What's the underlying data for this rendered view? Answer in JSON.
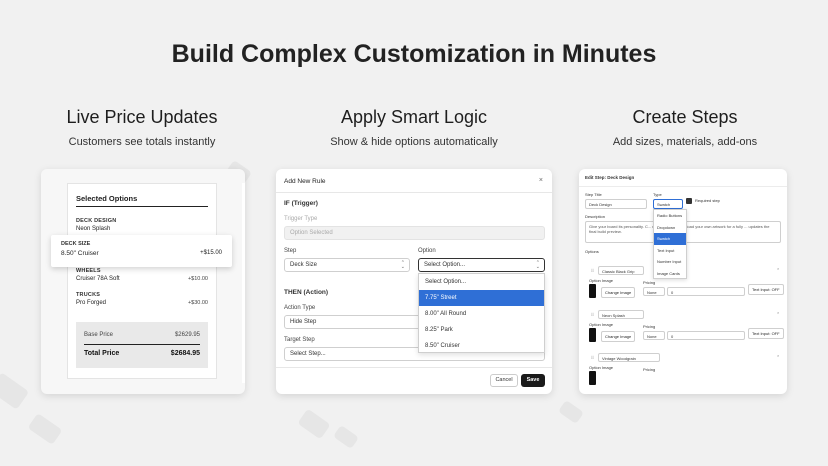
{
  "headline": "Build Complex Customization in Minutes",
  "columns": [
    {
      "title": "Live Price Updates",
      "subtitle": "Customers see totals instantly"
    },
    {
      "title": "Apply Smart Logic",
      "subtitle": "Show & hide options automatically"
    },
    {
      "title": "Create Steps",
      "subtitle": "Add sizes, materials, add-ons"
    }
  ],
  "card1": {
    "heading": "Selected Options",
    "deck_design_label": "DECK DESIGN",
    "deck_design_value": "Neon Splash",
    "popup_label": "DECK SIZE",
    "popup_value": "8.50\" Cruiser",
    "popup_price": "+$15.00",
    "wheels_label": "WHEELS",
    "wheels_value": "Cruiser 78A Soft",
    "wheels_price": "+$10.00",
    "trucks_label": "TRUCKS",
    "trucks_value": "Pro Forged",
    "trucks_price": "+$30.00",
    "base_label": "Base Price",
    "base_value": "$2629.95",
    "total_label": "Total Price",
    "total_value": "$2684.95"
  },
  "card2": {
    "title": "Add New Rule",
    "close": "×",
    "if_heading": "IF (Trigger)",
    "trigger_type_label": "Trigger Type",
    "trigger_type_value": "Option Selected",
    "step_label": "Step",
    "step_value": "Deck Size",
    "option_label": "Option",
    "option_value": "Select Option...",
    "dropdown_options": [
      "Select Option...",
      "7.75\" Street",
      "8.00\" All Round",
      "8.25\" Park",
      "8.50\" Cruiser"
    ],
    "dropdown_selected_index": 1,
    "then_heading": "THEN (Action)",
    "action_type_label": "Action Type",
    "action_type_value": "Hide Step",
    "target_step_label": "Target Step",
    "target_step_value": "Select Step...",
    "cancel_label": "Cancel",
    "save_label": "Save"
  },
  "card3": {
    "title": "Edit Step: Deck Design",
    "step_title_label": "Step Title",
    "step_title_value": "Deck Design",
    "type_label": "Type",
    "type_value": "Swatch",
    "required_label": "Required step",
    "description_label": "Description",
    "description_text": "Give your board its personality. C... more designs or upload your own artwork for a fully ... updates the final build preview.",
    "type_menu": [
      "Radio Buttons",
      "Dropdown",
      "Swatch",
      "Text Input",
      "Number Input",
      "Image Cards"
    ],
    "type_menu_selected_index": 2,
    "options_label": "Options",
    "option_rows": [
      {
        "name": "Classic Black Grip"
      },
      {
        "name": "Neon Splash"
      },
      {
        "name": "Vintage Woodgrain"
      }
    ],
    "option_image_label": "Option Image",
    "change_image_label": "Change Image",
    "pricing_label": "Pricing",
    "pricing_type": "None",
    "pricing_value": "0",
    "text_input_label": "Text Input: OFF",
    "remove": "×"
  }
}
